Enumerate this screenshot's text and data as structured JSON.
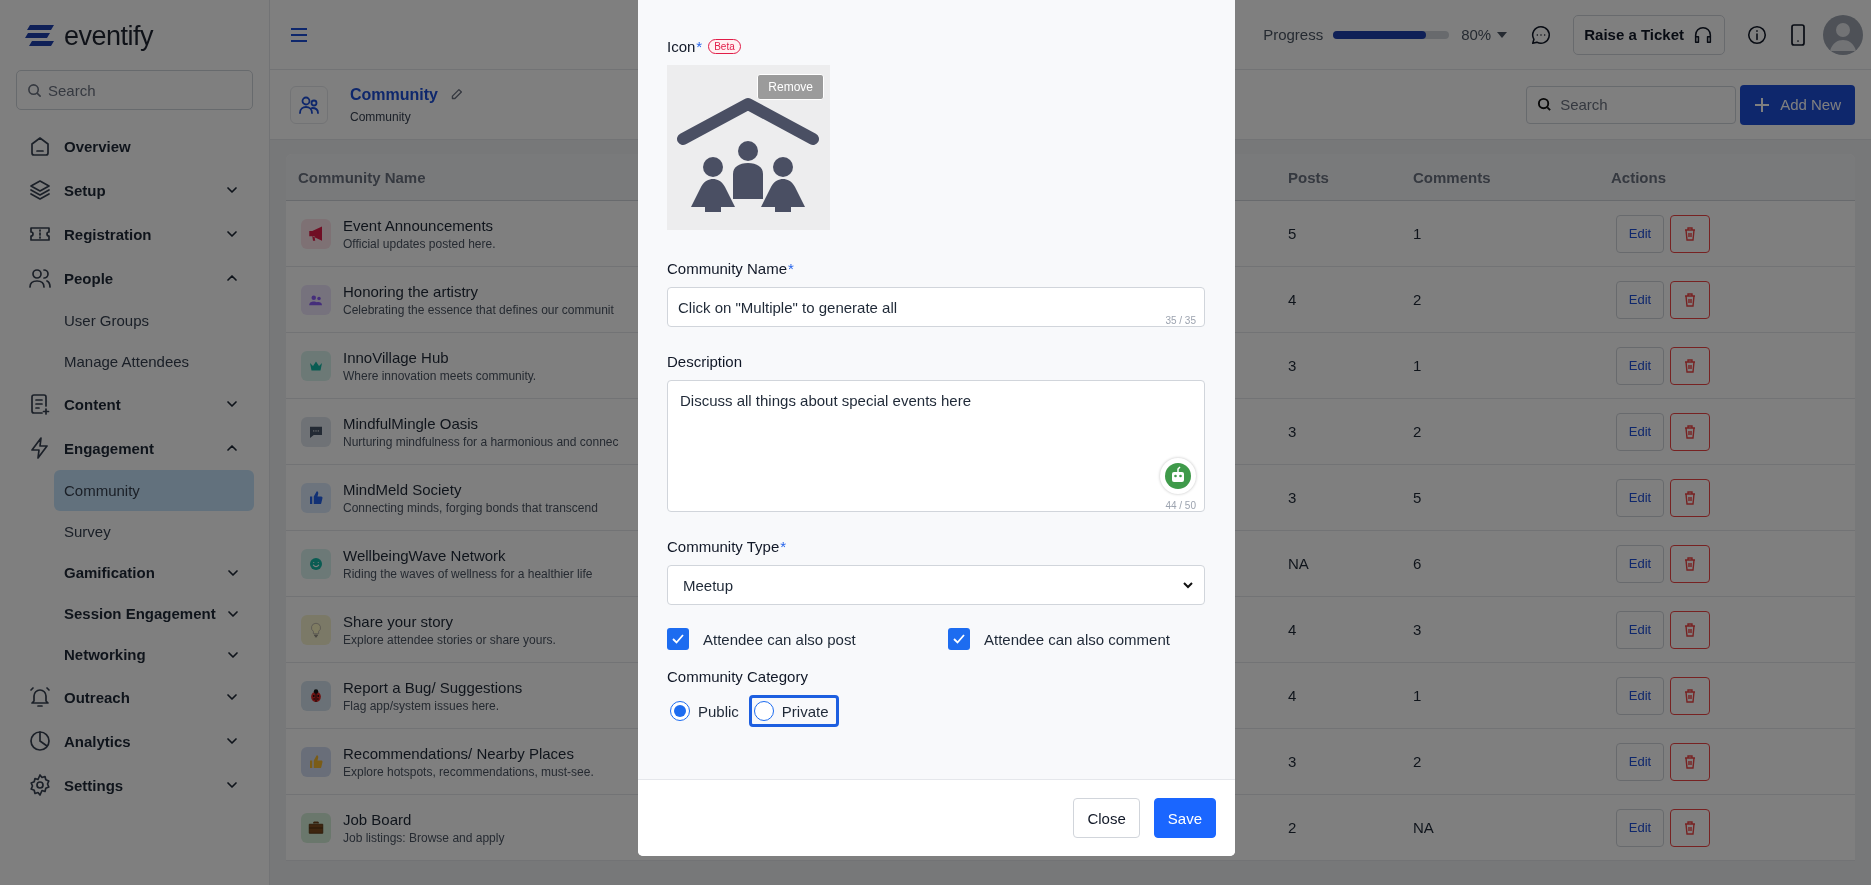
{
  "sidebar": {
    "logo": "eventify",
    "search": {
      "placeholder": "Search"
    },
    "items": [
      {
        "label": "Overview",
        "kind": "link",
        "selected": false
      },
      {
        "label": "Setup",
        "kind": "group",
        "expanded": false,
        "selected": false
      },
      {
        "label": "Registration",
        "kind": "group",
        "expanded": false,
        "selected": false
      },
      {
        "label": "People",
        "kind": "group",
        "expanded": true,
        "selected": false,
        "children": [
          {
            "label": "User Groups",
            "kind": "link",
            "selected": false
          },
          {
            "label": "Manage Attendees",
            "kind": "link",
            "selected": false
          }
        ]
      },
      {
        "label": "Content",
        "kind": "group",
        "expanded": false,
        "selected": false
      },
      {
        "label": "Engagement",
        "kind": "group",
        "expanded": true,
        "selected": false,
        "children": [
          {
            "label": "Community",
            "kind": "link",
            "selected": true
          },
          {
            "label": "Survey",
            "kind": "link",
            "selected": false
          },
          {
            "label": "Gamification",
            "kind": "group",
            "expanded": false,
            "selected": false
          },
          {
            "label": "Session Engagement",
            "kind": "group",
            "expanded": false,
            "selected": false
          },
          {
            "label": "Networking",
            "kind": "group",
            "expanded": false,
            "selected": false
          }
        ]
      },
      {
        "label": "Outreach",
        "kind": "group",
        "expanded": false,
        "selected": false
      },
      {
        "label": "Analytics",
        "kind": "group",
        "expanded": false,
        "selected": false
      },
      {
        "label": "Settings",
        "kind": "group",
        "expanded": false,
        "selected": false
      }
    ]
  },
  "topbar": {
    "progress": {
      "label": "Progress",
      "level": 0.8,
      "reading": "80%"
    },
    "ticket_button": "Raise a Ticket"
  },
  "page_header": {
    "title": "Community",
    "subtitle": "Community",
    "search": {
      "placeholder": "Search"
    },
    "add_button": "Add New"
  },
  "table": {
    "columns": [
      "Community Name",
      "Posts",
      "Comments",
      "Actions"
    ],
    "rows": [
      {
        "name": "Event Announcements",
        "description": "Official updates posted here.",
        "posts": "5",
        "comments": "1",
        "edit": "Edit"
      },
      {
        "name": "Honoring the artistry",
        "description": "Celebrating the essence that defines our communit",
        "posts": "4",
        "comments": "2",
        "edit": "Edit"
      },
      {
        "name": "InnoVillage Hub",
        "description": "Where innovation meets community.",
        "posts": "3",
        "comments": "1",
        "edit": "Edit"
      },
      {
        "name": "MindfulMingle Oasis",
        "description": "Nurturing mindfulness for a harmonious and connec",
        "posts": "3",
        "comments": "2",
        "edit": "Edit"
      },
      {
        "name": "MindMeld Society",
        "description": "Connecting minds, forging bonds that transcend",
        "posts": "3",
        "comments": "5",
        "edit": "Edit"
      },
      {
        "name": "WellbeingWave Network",
        "description": "Riding the waves of wellness for a healthier life",
        "posts": "NA",
        "comments": "6",
        "edit": "Edit"
      },
      {
        "name": "Share your story",
        "description": "Explore attendee stories or share yours.",
        "posts": "4",
        "comments": "3",
        "edit": "Edit"
      },
      {
        "name": "Report a Bug/ Suggestions",
        "description": "Flag app/system issues here.",
        "posts": "4",
        "comments": "1",
        "edit": "Edit"
      },
      {
        "name": "Recommendations/ Nearby Places",
        "description": "Explore hotspots, recommendations, must-see.",
        "posts": "3",
        "comments": "2",
        "edit": "Edit"
      },
      {
        "name": "Job Board",
        "description": "Job listings: Browse and apply",
        "posts": "2",
        "comments": "NA",
        "edit": "Edit"
      }
    ]
  },
  "modal": {
    "icon_field": {
      "label": "Icon",
      "required_mark": "*",
      "badge": "Beta",
      "remove_button": "Remove"
    },
    "name_field": {
      "label": "Community Name",
      "required_mark": "*",
      "value": "Click on \"Multiple\" to generate all",
      "counter": "35 / 35"
    },
    "description_field": {
      "label": "Description",
      "value": "Discuss all things about special events here",
      "counter": "44 / 50"
    },
    "type_field": {
      "label": "Community Type",
      "required_mark": "*",
      "value": "Meetup"
    },
    "checkboxes": [
      {
        "label": "Attendee can also post",
        "checked": true
      },
      {
        "label": "Attendee can also comment",
        "checked": true
      }
    ],
    "category": {
      "label": "Community Category",
      "options": [
        {
          "label": "Public",
          "selected": true,
          "focused": false
        },
        {
          "label": "Private",
          "selected": false,
          "focused": true
        }
      ]
    },
    "buttons": [
      {
        "label": "Close",
        "kind": "secondary"
      },
      {
        "label": "Save",
        "kind": "primary"
      }
    ]
  }
}
